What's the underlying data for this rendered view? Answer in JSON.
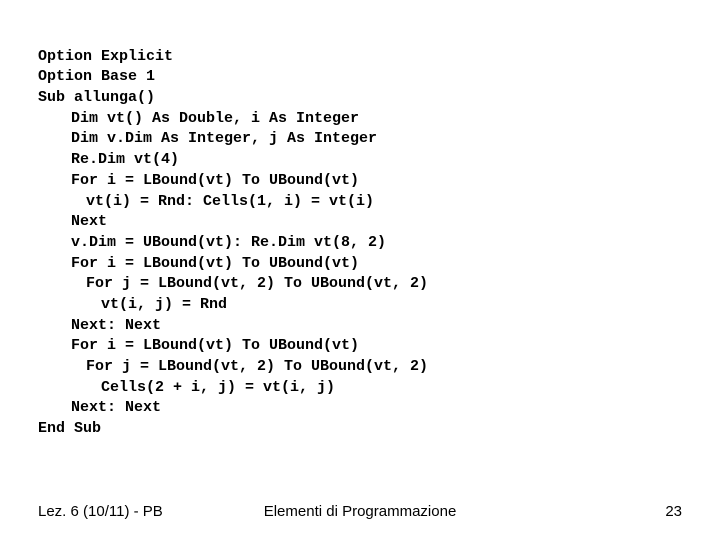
{
  "code": {
    "l1": "Option Explicit",
    "l2": "Option Base 1",
    "l3": "Sub allunga()",
    "l4": "Dim vt() As Double, i As Integer",
    "l5": "Dim v.Dim As Integer, j As Integer",
    "l6": "Re.Dim vt(4)",
    "l7": "For i = LBound(vt) To UBound(vt)",
    "l8": "vt(i) = Rnd: Cells(1, i) = vt(i)",
    "l9": "Next",
    "l10": "v.Dim = UBound(vt): Re.Dim vt(8, 2)",
    "l11": "For i = LBound(vt) To UBound(vt)",
    "l12": "For j = LBound(vt, 2) To UBound(vt, 2)",
    "l13": "vt(i, j) = Rnd",
    "l14": "Next: Next",
    "l15": "For i = LBound(vt) To UBound(vt)",
    "l16": "For j = LBound(vt, 2) To UBound(vt, 2)",
    "l17": "Cells(2 + i, j) = vt(i, j)",
    "l18": "Next: Next",
    "l19": "End Sub"
  },
  "footer": {
    "left": "Lez. 6 (10/11) - PB",
    "center": "Elementi di Programmazione",
    "page": "23"
  }
}
